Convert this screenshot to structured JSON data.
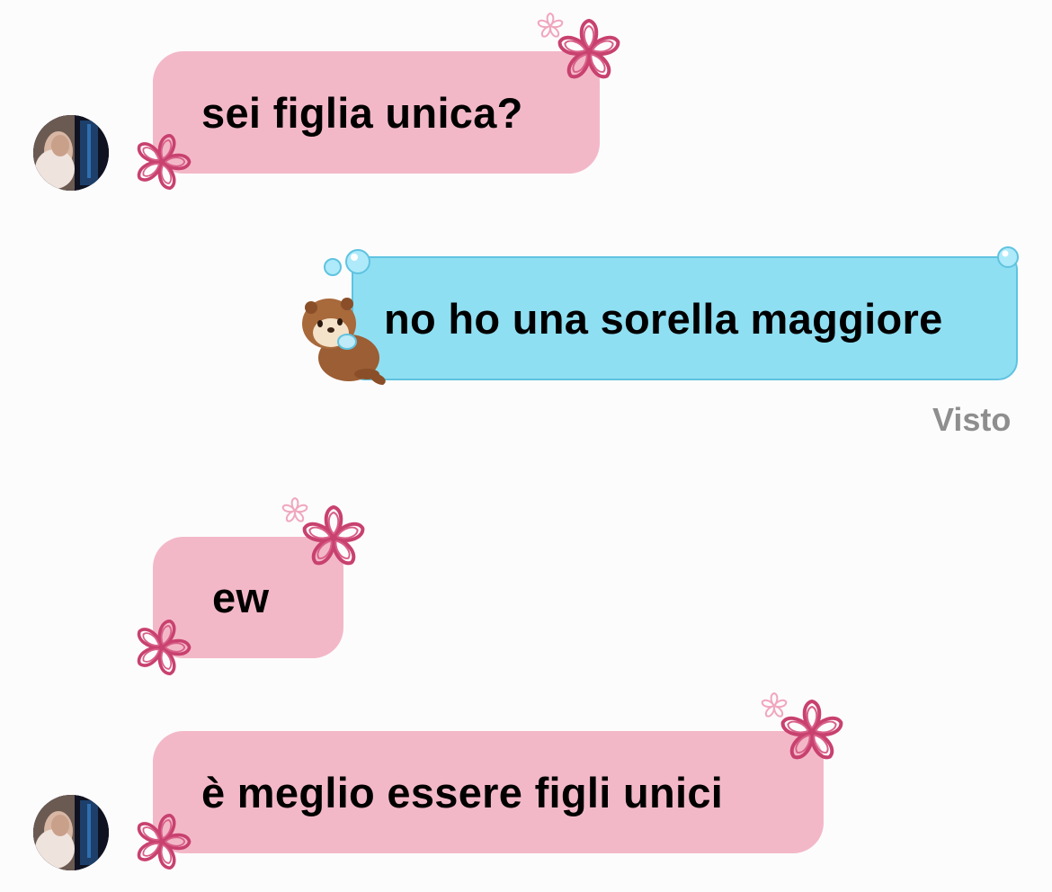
{
  "messages": [
    {
      "id": "m1",
      "direction": "incoming",
      "text": "sei figlia unica?",
      "avatar": true
    },
    {
      "id": "m2",
      "direction": "outgoing",
      "text": "no ho una sorella maggiore"
    },
    {
      "id": "m3",
      "direction": "incoming",
      "text": "ew",
      "avatar": false
    },
    {
      "id": "m4",
      "direction": "incoming",
      "text": "è meglio essere figli unici",
      "avatar": true
    }
  ],
  "status": {
    "seen_label": "Visto"
  },
  "colors": {
    "incoming_bubble": "#f3b8c8",
    "outgoing_bubble": "#8fdff2",
    "outgoing_border": "#5fc3e0",
    "flower_dark": "#c8416f",
    "flower_light": "#f0a7bd",
    "seen_text": "#8e8e8e"
  },
  "icons": [
    "contact-avatar",
    "flower-sticker",
    "otter-sticker",
    "bubble-droplet"
  ]
}
